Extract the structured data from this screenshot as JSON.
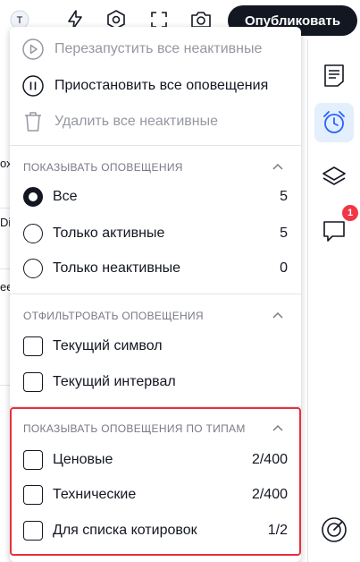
{
  "toolbar": {
    "avatar_letter": "T",
    "publish_label": "Опубликовать",
    "icons": [
      "user-avatar-icon",
      "lightning-icon",
      "settings-hex-icon",
      "fullscreen-icon",
      "camera-icon"
    ]
  },
  "background": {
    "fragments": [
      "ох",
      "Di",
      "ee"
    ]
  },
  "sidebar": {
    "items": [
      {
        "icon": "watchlist-icon",
        "active": false
      },
      {
        "icon": "alarm-clock-icon",
        "active": true
      },
      {
        "icon": "layers-icon",
        "active": false
      },
      {
        "icon": "chat-icon",
        "active": false,
        "badge": "1"
      },
      {
        "icon": "target-icon",
        "active": false
      }
    ],
    "badge": "1",
    "accent": "#2962ff"
  },
  "menu": {
    "actions": [
      {
        "label": "Перезапустить все неактивные",
        "icon": "play-circle-icon",
        "disabled": true
      },
      {
        "label": "Приостановить все оповещения",
        "icon": "pause-circle-icon",
        "disabled": false
      },
      {
        "label": "Удалить все неактивные",
        "icon": "trash-icon",
        "disabled": true
      }
    ],
    "show_section": {
      "title": "ПОКАЗЫВАТЬ ОПОВЕЩЕНИЯ",
      "options": [
        {
          "label": "Все",
          "count": "5",
          "selected": true
        },
        {
          "label": "Только активные",
          "count": "5",
          "selected": false
        },
        {
          "label": "Только неактивные",
          "count": "0",
          "selected": false
        }
      ]
    },
    "filter_section": {
      "title": "ОТФИЛЬТРОВАТЬ ОПОВЕЩЕНИЯ",
      "options": [
        {
          "label": "Текущий символ",
          "checked": false
        },
        {
          "label": "Текущий интервал",
          "checked": false
        }
      ]
    },
    "types_section": {
      "title": "ПОКАЗЫВАТЬ ОПОВЕЩЕНИЯ ПО ТИПАМ",
      "options": [
        {
          "label": "Ценовые",
          "count": "2/400",
          "checked": false
        },
        {
          "label": "Технические",
          "count": "2/400",
          "checked": false
        },
        {
          "label": "Для списка котировок",
          "count": "1/2",
          "checked": false
        }
      ]
    },
    "highlight_color": "#e8303c"
  }
}
